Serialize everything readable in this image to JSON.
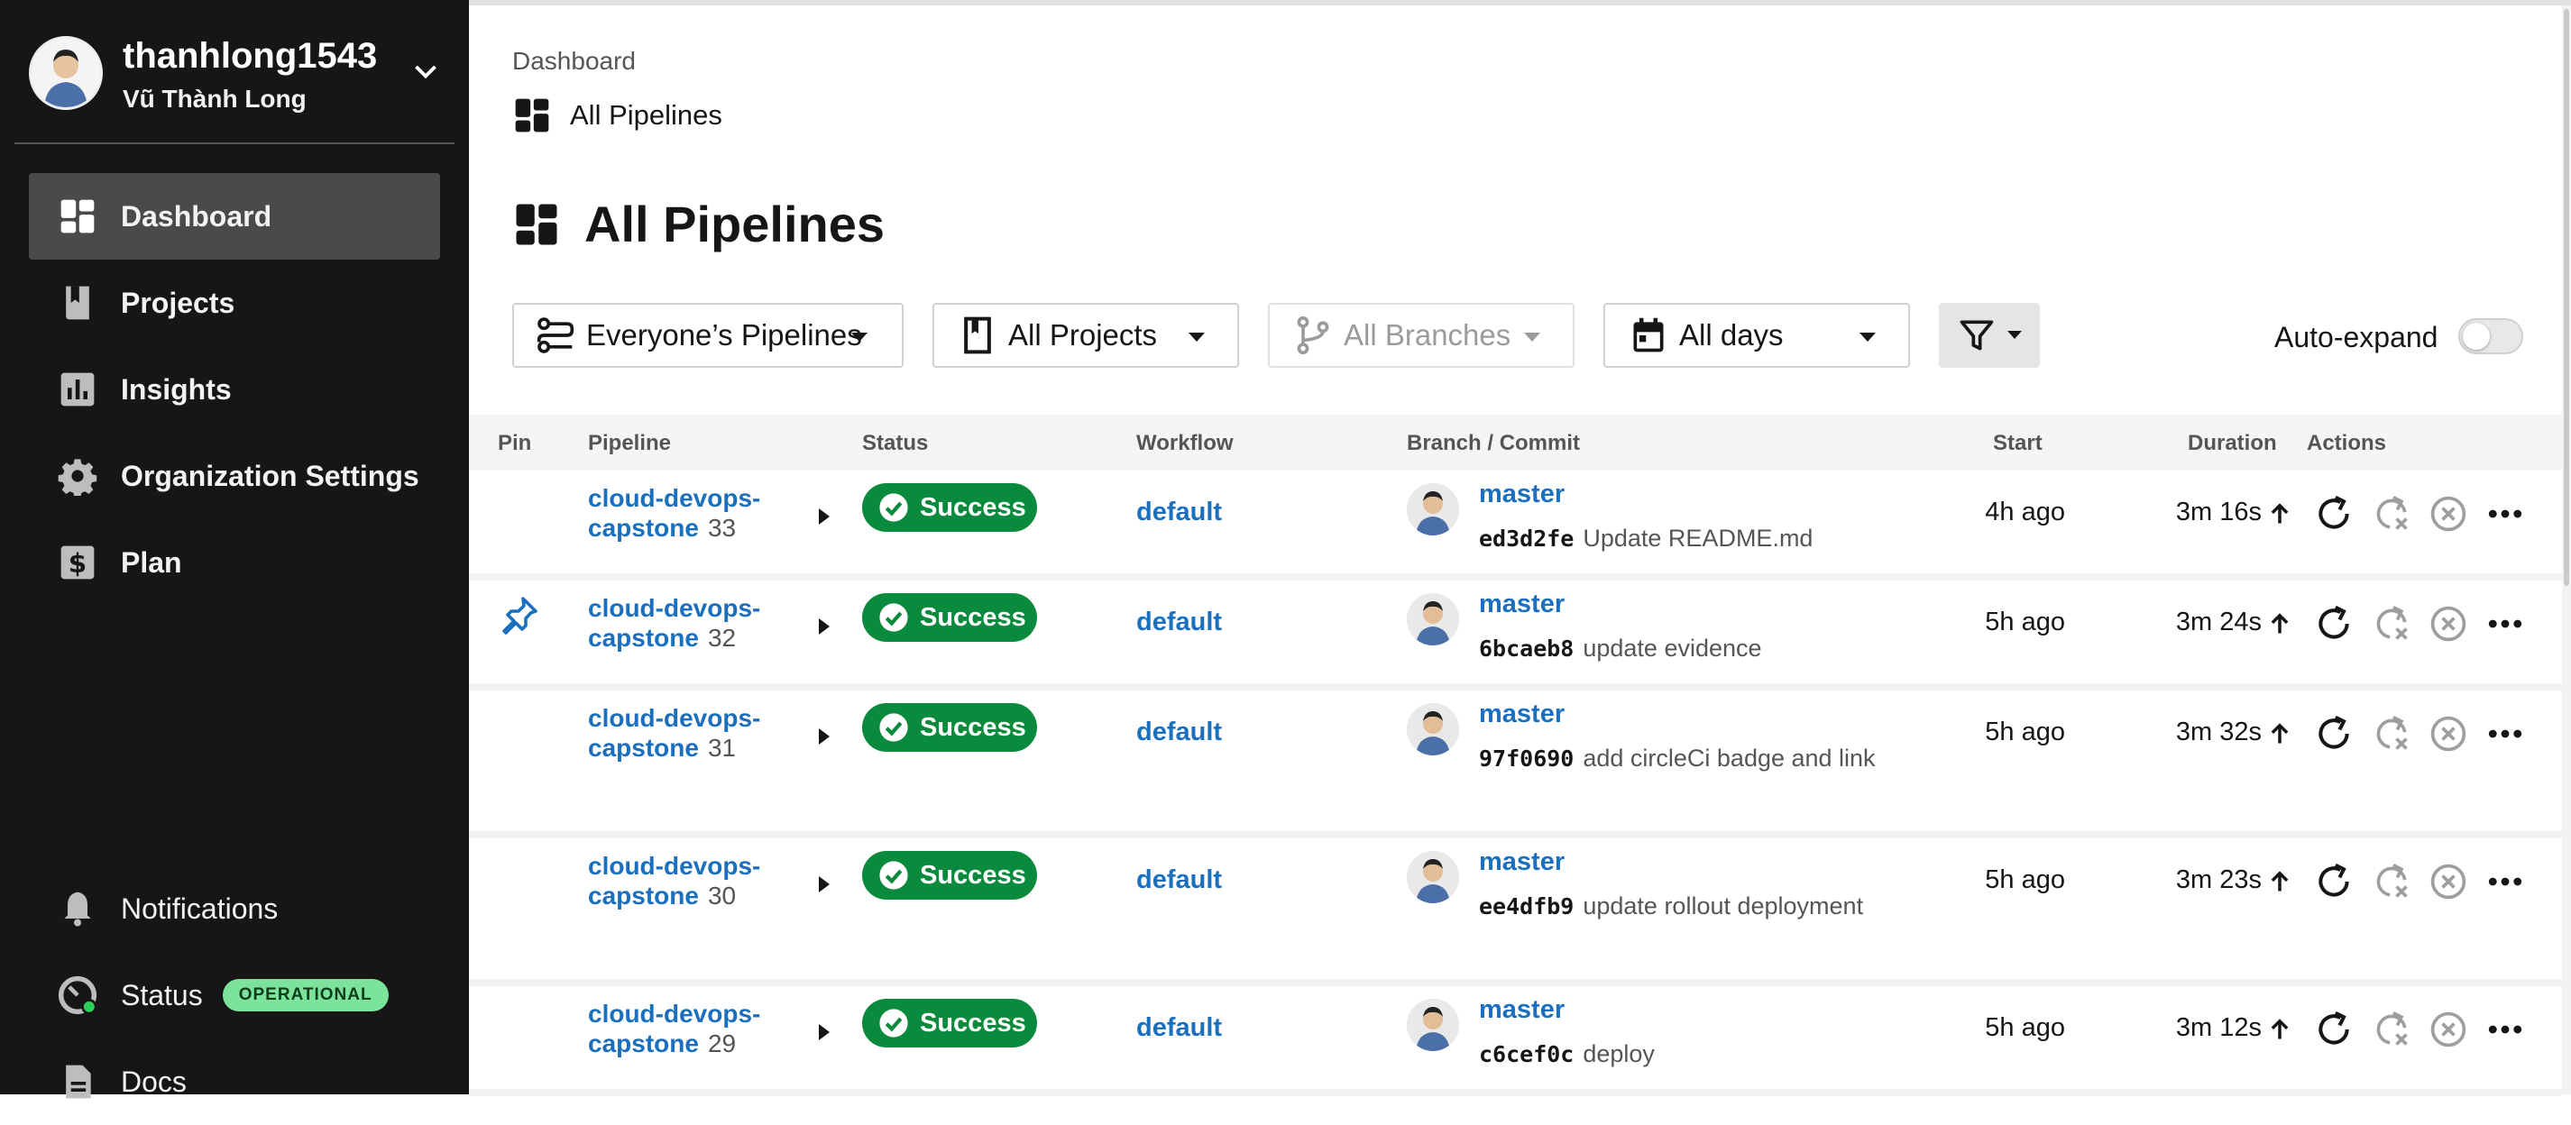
{
  "user": {
    "username": "thanhlong1543",
    "full_name": "Vũ Thành Long"
  },
  "sidebar": {
    "items": [
      {
        "label": "Dashboard",
        "icon": "dashboard-icon",
        "active": true
      },
      {
        "label": "Projects",
        "icon": "book-icon"
      },
      {
        "label": "Insights",
        "icon": "bar-chart-icon"
      },
      {
        "label": "Organization Settings",
        "icon": "gear-icon"
      },
      {
        "label": "Plan",
        "icon": "dollar-icon"
      }
    ],
    "bottom_items": [
      {
        "label": "Notifications",
        "icon": "bell-icon"
      },
      {
        "label": "Status",
        "icon": "gauge-icon",
        "badge": "OPERATIONAL"
      },
      {
        "label": "Docs",
        "icon": "document-icon"
      }
    ]
  },
  "header": {
    "breadcrumb": "Dashboard",
    "subtitle": "All Pipelines",
    "title": "All Pipelines"
  },
  "filters": {
    "pipelines": "Everyone’s Pipelines",
    "projects": "All Projects",
    "branches": "All Branches",
    "days": "All days",
    "auto_expand_label": "Auto-expand",
    "auto_expand_on": false
  },
  "table": {
    "headers": {
      "pin": "Pin",
      "pipeline": "Pipeline",
      "status": "Status",
      "workflow": "Workflow",
      "branch_commit": "Branch / Commit",
      "start": "Start",
      "duration": "Duration",
      "actions": "Actions"
    },
    "rows": [
      {
        "project_line1": "cloud-devops-",
        "project_line2": "capstone",
        "number": "33",
        "pinned": false,
        "status": "Success",
        "workflow": "default",
        "branch": "master",
        "sha": "ed3d2fe",
        "message": "Update README.md",
        "start": "4h ago",
        "duration": "3m 16s"
      },
      {
        "project_line1": "cloud-devops-",
        "project_line2": "capstone",
        "number": "32",
        "pinned": true,
        "status": "Success",
        "workflow": "default",
        "branch": "master",
        "sha": "6bcaeb8",
        "message": "update evidence",
        "start": "5h ago",
        "duration": "3m 24s"
      },
      {
        "project_line1": "cloud-devops-",
        "project_line2": "capstone",
        "number": "31",
        "pinned": false,
        "status": "Success",
        "workflow": "default",
        "branch": "master",
        "sha": "97f0690",
        "message": "add circleCi badge and link",
        "start": "5h ago",
        "duration": "3m 32s"
      },
      {
        "project_line1": "cloud-devops-",
        "project_line2": "capstone",
        "number": "30",
        "pinned": false,
        "status": "Success",
        "workflow": "default",
        "branch": "master",
        "sha": "ee4dfb9",
        "message": "update rollout deployment",
        "start": "5h ago",
        "duration": "3m 23s"
      },
      {
        "project_line1": "cloud-devops-",
        "project_line2": "capstone",
        "number": "29",
        "pinned": false,
        "status": "Success",
        "workflow": "default",
        "branch": "master",
        "sha": "c6cef0c",
        "message": "deploy",
        "start": "5h ago",
        "duration": "3m 12s"
      }
    ]
  },
  "colors": {
    "sidebar_bg": "#161616",
    "link": "#1a6fbf",
    "success": "#0a8a3c",
    "operational": "#7be39a"
  }
}
